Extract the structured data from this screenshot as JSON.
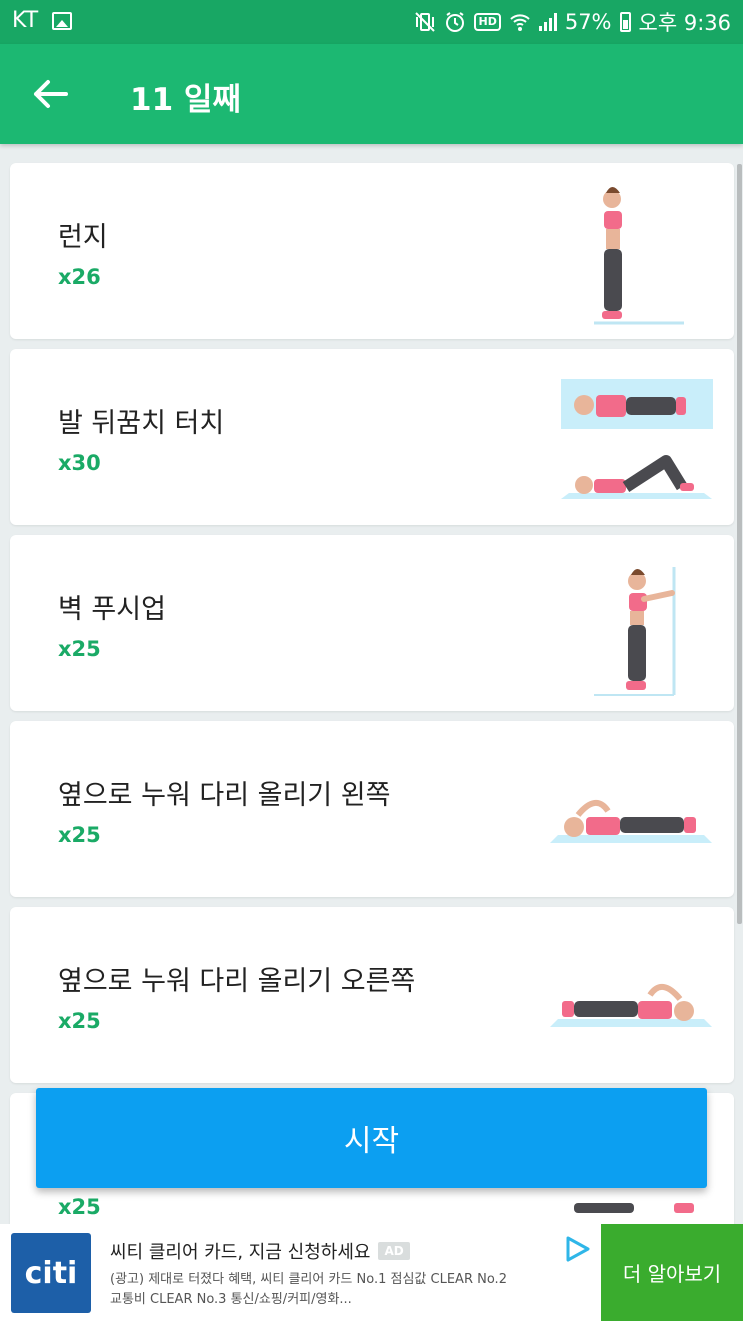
{
  "status_bar": {
    "carrier": "KT",
    "hd_label": "HD",
    "battery": "57%",
    "time": "오후 9:36"
  },
  "app_bar": {
    "title": "11 일째"
  },
  "exercises": [
    {
      "name": "런지",
      "count": "x26",
      "illustration": "lunge-figure"
    },
    {
      "name": "발 뒤꿈치 터치",
      "count": "x30",
      "illustration": "heel-touch-figure"
    },
    {
      "name": "벽 푸시업",
      "count": "x25",
      "illustration": "wall-pushup-figure"
    },
    {
      "name": "옆으로 누워 다리 올리기 왼쪽",
      "count": "x25",
      "illustration": "side-leg-lift-left-figure"
    },
    {
      "name": "옆으로 누워 다리 올리기 오른쪽",
      "count": "x25",
      "illustration": "side-leg-lift-right-figure"
    },
    {
      "name": "",
      "count": "x25",
      "illustration": "partial-figure"
    }
  ],
  "start_button": {
    "label": "시작"
  },
  "ad": {
    "logo_text": "citi",
    "title": "씨티 클리어 카드, 지금 신청하세요",
    "badge": "AD",
    "description": "(광고) 제대로 터졌다 혜택, 씨티 클리어 카드 No.1 점심값 CLEAR No.2 교통비 CLEAR No.3 통신/쇼핑/커피/영화...",
    "cta": "더 알아보기"
  },
  "colors": {
    "status_bar": "#18a764",
    "app_bar": "#1cb872",
    "accent_green": "#1aaa66",
    "start_button": "#0c9ff1",
    "ad_cta": "#3aac2e",
    "citi_blue": "#1d5fa8"
  }
}
